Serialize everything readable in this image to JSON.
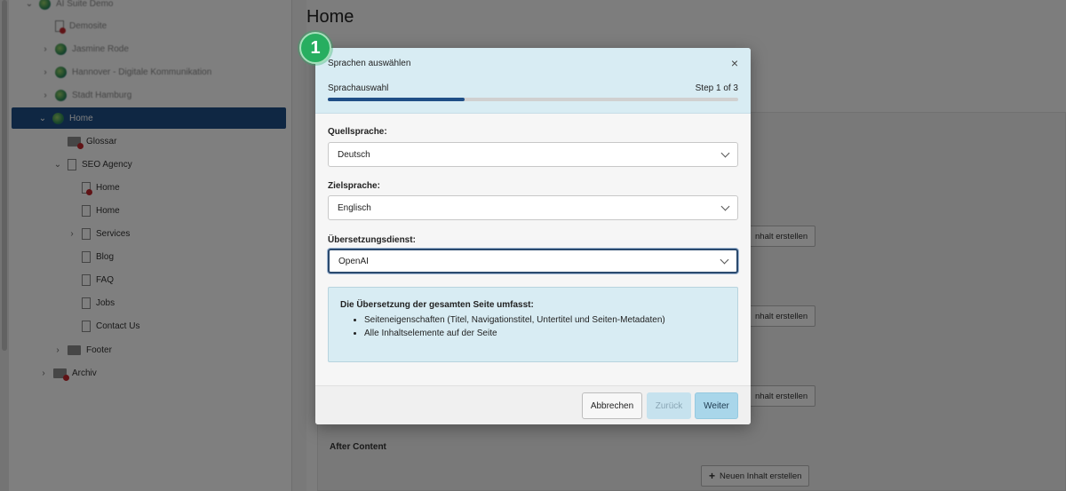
{
  "tree": {
    "root": "AI Suite Demo",
    "items_blurred": [
      "Demosite",
      "Jasmine Rode",
      "Hannover - Digitale Kommunikation",
      "Stadt Hamburg"
    ],
    "home": "Home",
    "glossar": "Glossar",
    "seo_agency": "SEO Agency",
    "seo_children": [
      "Home",
      "Home",
      "Services",
      "Blog",
      "FAQ",
      "Jobs",
      "Contact Us"
    ],
    "footer": "Footer",
    "archiv": "Archiv"
  },
  "content": {
    "page_title": "Home",
    "new_content_label": "Neuen Inhalt erstellen",
    "new_content_partial": "nhalt erstellen",
    "after_content": "After Content"
  },
  "modal": {
    "title": "Sprachen auswählen",
    "close": "×",
    "step_name": "Sprachauswahl",
    "step_count": "Step 1 of 3",
    "progress_fraction": 0.333,
    "source_label": "Quellsprache:",
    "source_value": "Deutsch",
    "target_label": "Zielsprache:",
    "target_value": "Englisch",
    "service_label": "Übersetzungsdienst:",
    "service_value": "OpenAI",
    "info_title": "Die Übersetzung der gesamten Seite umfasst:",
    "info_items": [
      "Seiteneigenschaften (Titel, Navigationstitel, Untertitel und Seiten-Metadaten)",
      "Alle Inhaltselemente auf der Seite"
    ],
    "cancel": "Abbrechen",
    "back": "Zurück",
    "next": "Weiter"
  },
  "step_badge": "1",
  "colors": {
    "accent": "#1f4e86",
    "modal_header": "#d8ecf3",
    "badge": "#27ae60"
  }
}
